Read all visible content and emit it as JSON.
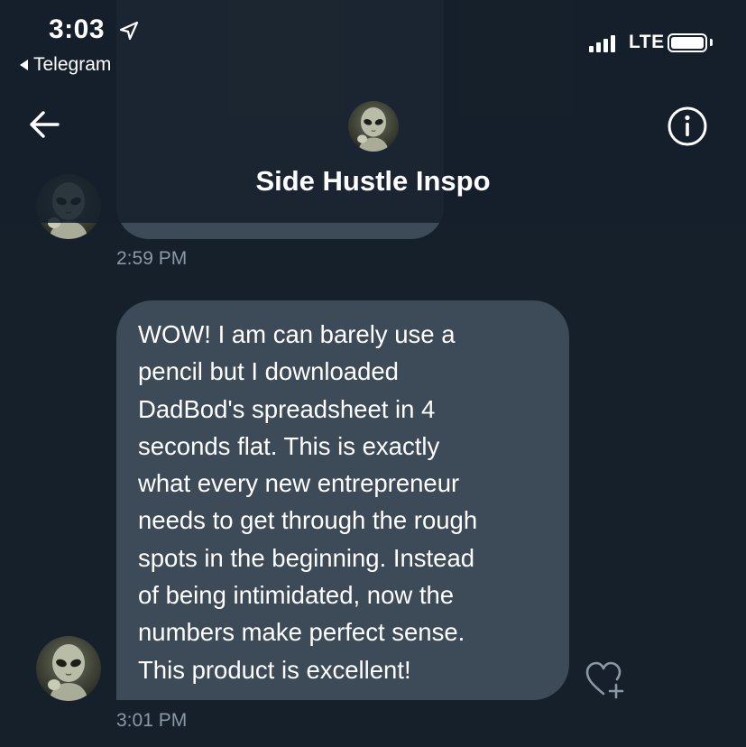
{
  "status_bar": {
    "time": "3:03",
    "back_app": "Telegram",
    "network": "LTE"
  },
  "header": {
    "title": "Side Hustle Inspo"
  },
  "messages": [
    {
      "time": "2:59 PM"
    },
    {
      "text": "WOW!  I am can barely use a\npencil but I downloaded\nDadBod's spreadsheet in 4\nseconds flat.  This is exactly\nwhat every new entrepreneur\nneeds to get through the rough\nspots in the beginning.  Instead\nof being intimidated, now the\nnumbers make perfect sense.\nThis product is excellent!",
      "time": "3:01 PM"
    }
  ],
  "icons": {
    "back": "arrow-left-icon",
    "info": "info-icon",
    "react": "heart-plus-icon",
    "location": "location-arrow-icon"
  },
  "colors": {
    "background": "#15202b",
    "bubble": "#3d4a57",
    "timestamp": "#8b98a5"
  }
}
